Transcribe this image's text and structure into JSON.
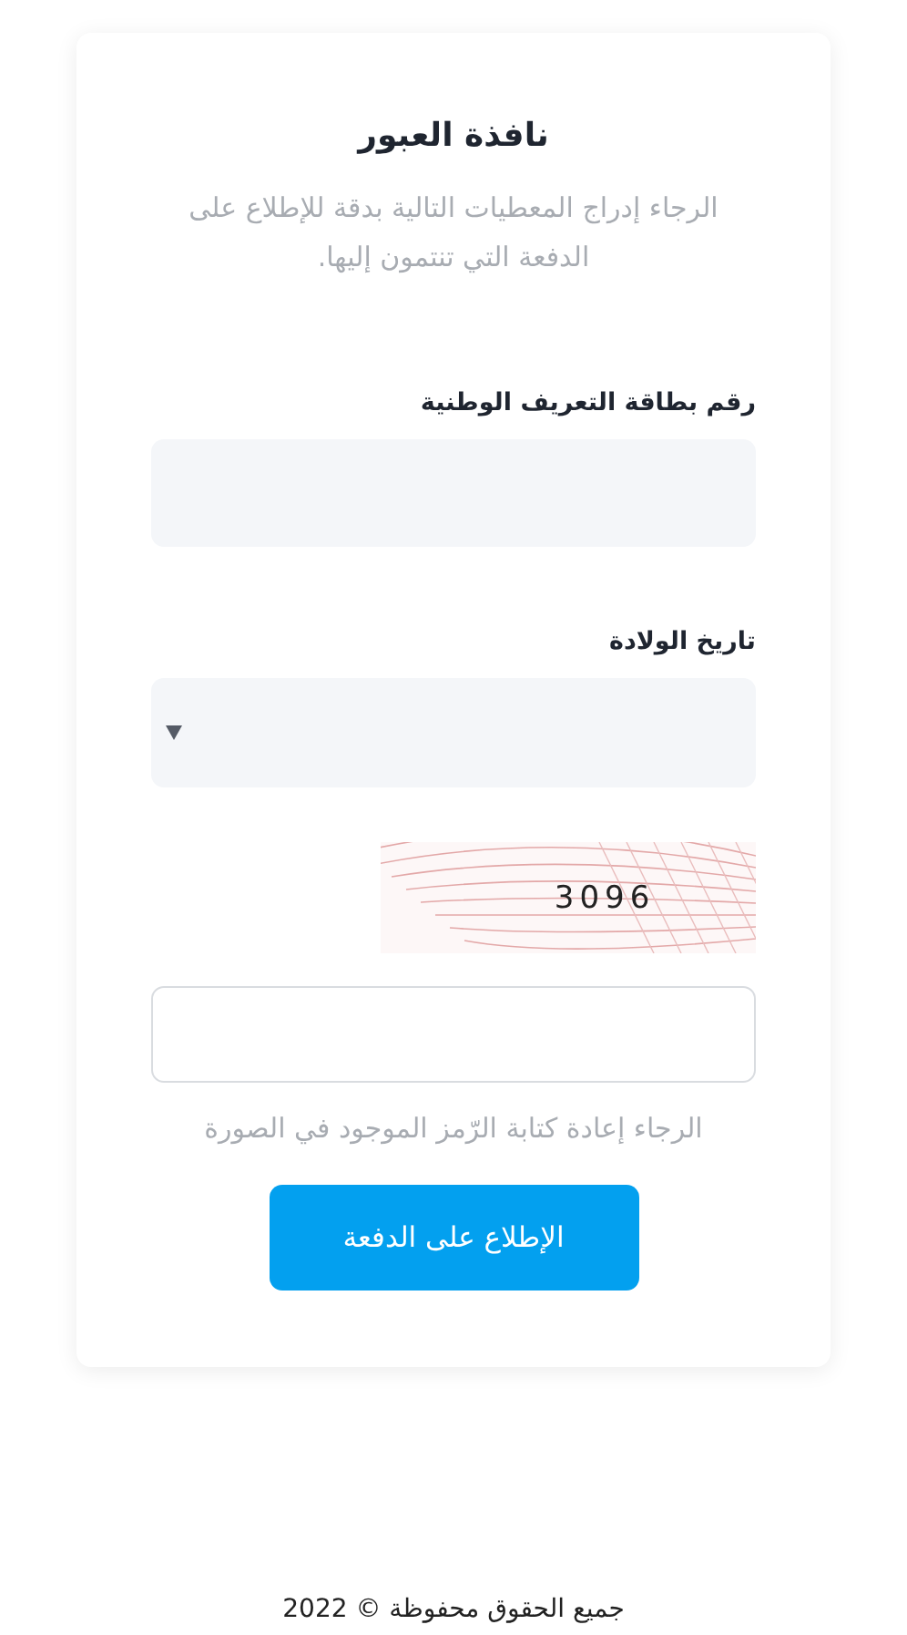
{
  "card": {
    "title": "نافذة العبور",
    "subtitle": "الرجاء إدراج المعطيات التالية بدقة للإطلاع على الدفعة التي تنتمون إليها."
  },
  "fields": [
    {
      "kind": "text",
      "label": "رقم بطاقة التعريف الوطنية"
    },
    {
      "kind": "select",
      "label": "تاريخ الولادة"
    }
  ],
  "captcha": {
    "code": "3096",
    "hint": "الرجاء إعادة كتابة الرّمز الموجود في الصورة"
  },
  "submit": {
    "label": "الإطلاع على الدفعة"
  },
  "footer": "جميع الحقوق محفوظة © 2022"
}
